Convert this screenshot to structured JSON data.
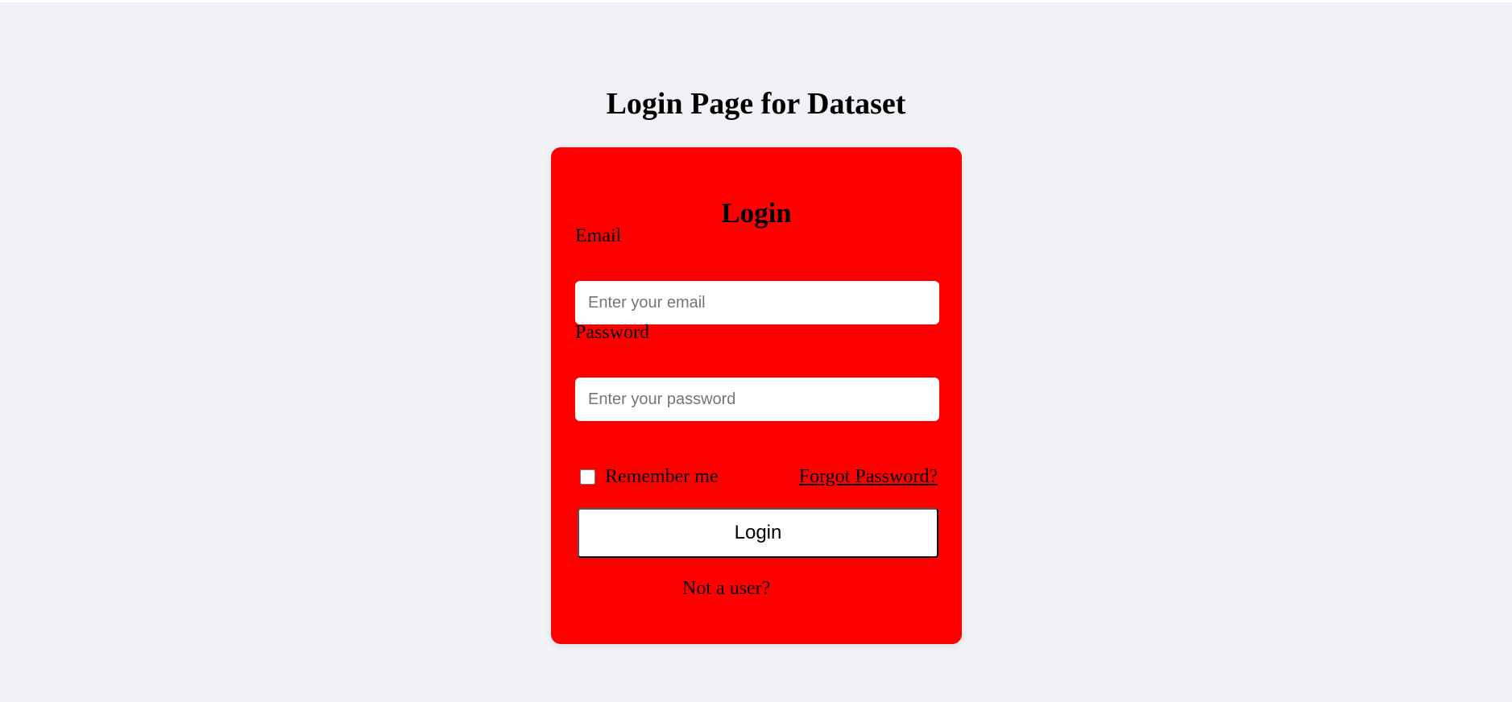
{
  "page": {
    "title": "Login Page for Dataset"
  },
  "card": {
    "heading": "Login",
    "email_label": "Email",
    "email_placeholder": "Enter your email",
    "password_label": "Password",
    "password_placeholder": "Enter your password",
    "remember_label": "Remember me",
    "forgot_link": "Forgot Password?",
    "login_button": "Login",
    "not_user_link": "Not a user?"
  },
  "colors": {
    "card": "#ff0000",
    "background": "#f0f2f5"
  }
}
